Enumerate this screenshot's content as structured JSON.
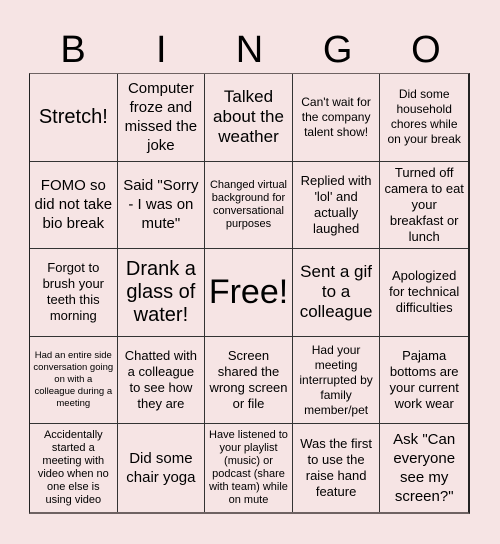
{
  "header": {
    "letters": [
      "B",
      "I",
      "N",
      "G",
      "O"
    ]
  },
  "colors": {
    "background": "#f6e4e4",
    "grid_line": "#333333",
    "text": "#000000"
  },
  "board": {
    "rows": [
      [
        "Stretch!",
        "Computer froze and missed the joke",
        "Talked about the weather",
        "Can't wait for the company talent show!",
        "Did some household chores while on your break"
      ],
      [
        "FOMO so did not take bio break",
        "Said \"Sorry - I was on mute\"",
        "Changed virtual background for conversational purposes",
        "Replied with 'lol' and actually laughed",
        "Turned off camera to eat your breakfast or lunch"
      ],
      [
        "Forgot to brush your teeth this morning",
        "Drank a glass of water!",
        "Free!",
        "Sent a gif to a colleague",
        "Apologized for technical difficulties"
      ],
      [
        "Had an entire side conversation going on with a colleague during a meeting",
        "Chatted with a colleague to see how they are",
        "Screen shared the wrong screen or file",
        "Had your meeting interrupted by family member/pet",
        "Pajama bottoms are your current work wear"
      ],
      [
        "Accidentally started a meeting with video when no one else is using video",
        "Did some chair yoga",
        "Have listened to your playlist (music) or podcast (share with team) while on mute",
        "Was the first to use the raise hand feature",
        "Ask \"Can everyone see my screen?\""
      ]
    ]
  }
}
